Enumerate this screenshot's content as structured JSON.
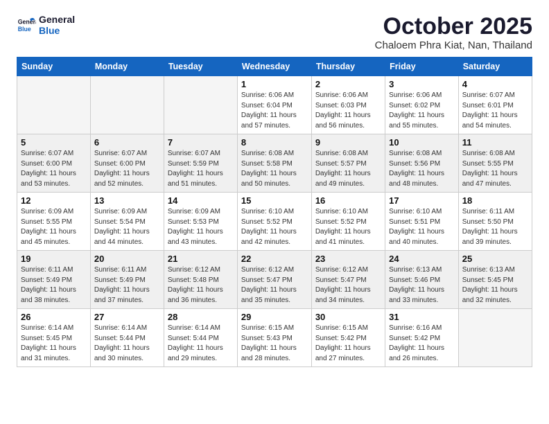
{
  "header": {
    "logo_line1": "General",
    "logo_line2": "Blue",
    "month": "October 2025",
    "location": "Chaloem Phra Kiat, Nan, Thailand"
  },
  "weekdays": [
    "Sunday",
    "Monday",
    "Tuesday",
    "Wednesday",
    "Thursday",
    "Friday",
    "Saturday"
  ],
  "weeks": [
    [
      {
        "day": "",
        "info": ""
      },
      {
        "day": "",
        "info": ""
      },
      {
        "day": "",
        "info": ""
      },
      {
        "day": "1",
        "info": "Sunrise: 6:06 AM\nSunset: 6:04 PM\nDaylight: 11 hours\nand 57 minutes."
      },
      {
        "day": "2",
        "info": "Sunrise: 6:06 AM\nSunset: 6:03 PM\nDaylight: 11 hours\nand 56 minutes."
      },
      {
        "day": "3",
        "info": "Sunrise: 6:06 AM\nSunset: 6:02 PM\nDaylight: 11 hours\nand 55 minutes."
      },
      {
        "day": "4",
        "info": "Sunrise: 6:07 AM\nSunset: 6:01 PM\nDaylight: 11 hours\nand 54 minutes."
      }
    ],
    [
      {
        "day": "5",
        "info": "Sunrise: 6:07 AM\nSunset: 6:00 PM\nDaylight: 11 hours\nand 53 minutes."
      },
      {
        "day": "6",
        "info": "Sunrise: 6:07 AM\nSunset: 6:00 PM\nDaylight: 11 hours\nand 52 minutes."
      },
      {
        "day": "7",
        "info": "Sunrise: 6:07 AM\nSunset: 5:59 PM\nDaylight: 11 hours\nand 51 minutes."
      },
      {
        "day": "8",
        "info": "Sunrise: 6:08 AM\nSunset: 5:58 PM\nDaylight: 11 hours\nand 50 minutes."
      },
      {
        "day": "9",
        "info": "Sunrise: 6:08 AM\nSunset: 5:57 PM\nDaylight: 11 hours\nand 49 minutes."
      },
      {
        "day": "10",
        "info": "Sunrise: 6:08 AM\nSunset: 5:56 PM\nDaylight: 11 hours\nand 48 minutes."
      },
      {
        "day": "11",
        "info": "Sunrise: 6:08 AM\nSunset: 5:55 PM\nDaylight: 11 hours\nand 47 minutes."
      }
    ],
    [
      {
        "day": "12",
        "info": "Sunrise: 6:09 AM\nSunset: 5:55 PM\nDaylight: 11 hours\nand 45 minutes."
      },
      {
        "day": "13",
        "info": "Sunrise: 6:09 AM\nSunset: 5:54 PM\nDaylight: 11 hours\nand 44 minutes."
      },
      {
        "day": "14",
        "info": "Sunrise: 6:09 AM\nSunset: 5:53 PM\nDaylight: 11 hours\nand 43 minutes."
      },
      {
        "day": "15",
        "info": "Sunrise: 6:10 AM\nSunset: 5:52 PM\nDaylight: 11 hours\nand 42 minutes."
      },
      {
        "day": "16",
        "info": "Sunrise: 6:10 AM\nSunset: 5:52 PM\nDaylight: 11 hours\nand 41 minutes."
      },
      {
        "day": "17",
        "info": "Sunrise: 6:10 AM\nSunset: 5:51 PM\nDaylight: 11 hours\nand 40 minutes."
      },
      {
        "day": "18",
        "info": "Sunrise: 6:11 AM\nSunset: 5:50 PM\nDaylight: 11 hours\nand 39 minutes."
      }
    ],
    [
      {
        "day": "19",
        "info": "Sunrise: 6:11 AM\nSunset: 5:49 PM\nDaylight: 11 hours\nand 38 minutes."
      },
      {
        "day": "20",
        "info": "Sunrise: 6:11 AM\nSunset: 5:49 PM\nDaylight: 11 hours\nand 37 minutes."
      },
      {
        "day": "21",
        "info": "Sunrise: 6:12 AM\nSunset: 5:48 PM\nDaylight: 11 hours\nand 36 minutes."
      },
      {
        "day": "22",
        "info": "Sunrise: 6:12 AM\nSunset: 5:47 PM\nDaylight: 11 hours\nand 35 minutes."
      },
      {
        "day": "23",
        "info": "Sunrise: 6:12 AM\nSunset: 5:47 PM\nDaylight: 11 hours\nand 34 minutes."
      },
      {
        "day": "24",
        "info": "Sunrise: 6:13 AM\nSunset: 5:46 PM\nDaylight: 11 hours\nand 33 minutes."
      },
      {
        "day": "25",
        "info": "Sunrise: 6:13 AM\nSunset: 5:45 PM\nDaylight: 11 hours\nand 32 minutes."
      }
    ],
    [
      {
        "day": "26",
        "info": "Sunrise: 6:14 AM\nSunset: 5:45 PM\nDaylight: 11 hours\nand 31 minutes."
      },
      {
        "day": "27",
        "info": "Sunrise: 6:14 AM\nSunset: 5:44 PM\nDaylight: 11 hours\nand 30 minutes."
      },
      {
        "day": "28",
        "info": "Sunrise: 6:14 AM\nSunset: 5:44 PM\nDaylight: 11 hours\nand 29 minutes."
      },
      {
        "day": "29",
        "info": "Sunrise: 6:15 AM\nSunset: 5:43 PM\nDaylight: 11 hours\nand 28 minutes."
      },
      {
        "day": "30",
        "info": "Sunrise: 6:15 AM\nSunset: 5:42 PM\nDaylight: 11 hours\nand 27 minutes."
      },
      {
        "day": "31",
        "info": "Sunrise: 6:16 AM\nSunset: 5:42 PM\nDaylight: 11 hours\nand 26 minutes."
      },
      {
        "day": "",
        "info": ""
      }
    ]
  ]
}
